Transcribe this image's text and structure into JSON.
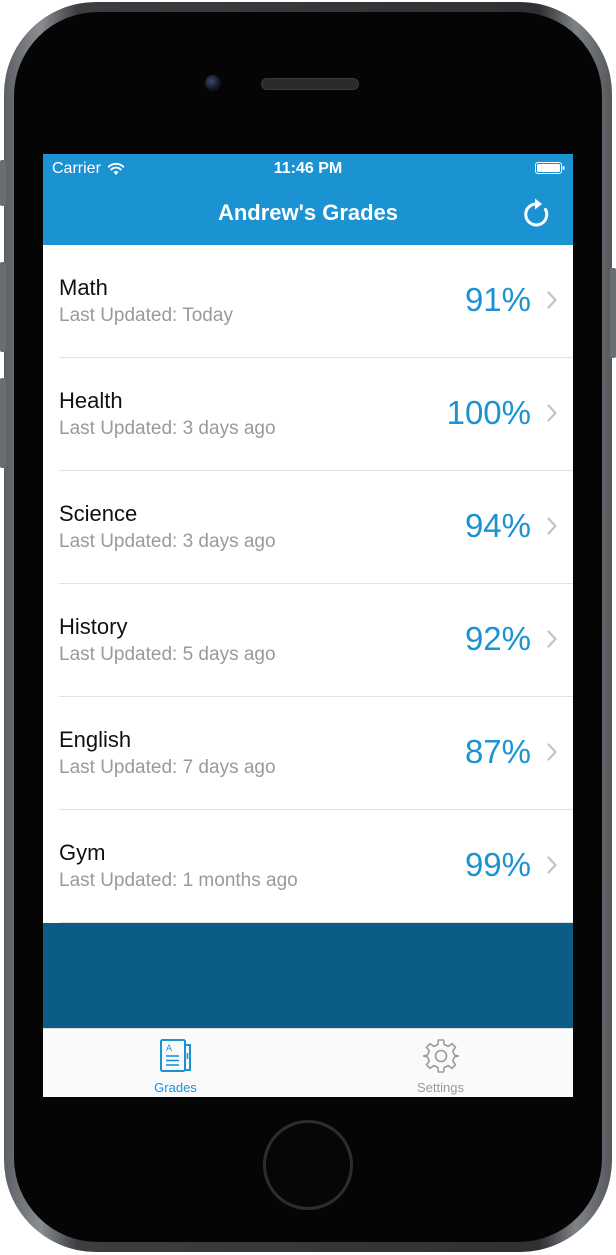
{
  "status_bar": {
    "carrier": "Carrier",
    "time": "11:46 PM"
  },
  "nav": {
    "title": "Andrew's Grades",
    "refresh_icon": "refresh-icon"
  },
  "grades": [
    {
      "subject": "Math",
      "updated": "Last Updated: Today",
      "grade": "91%"
    },
    {
      "subject": "Health",
      "updated": "Last Updated: 3 days ago",
      "grade": "100%"
    },
    {
      "subject": "Science",
      "updated": "Last Updated: 3 days ago",
      "grade": "94%"
    },
    {
      "subject": "History",
      "updated": "Last Updated: 5 days ago",
      "grade": "92%"
    },
    {
      "subject": "English",
      "updated": "Last Updated: 7 days ago",
      "grade": "87%"
    },
    {
      "subject": "Gym",
      "updated": "Last Updated: 1 months ago",
      "grade": "99%"
    }
  ],
  "tabs": [
    {
      "label": "Grades",
      "icon": "grades-document-icon",
      "active": true
    },
    {
      "label": "Settings",
      "icon": "gear-icon",
      "active": false
    }
  ],
  "colors": {
    "accent": "#1b93d3",
    "panel": "#0b5d86",
    "inactive_tab": "#9a9a9a"
  }
}
